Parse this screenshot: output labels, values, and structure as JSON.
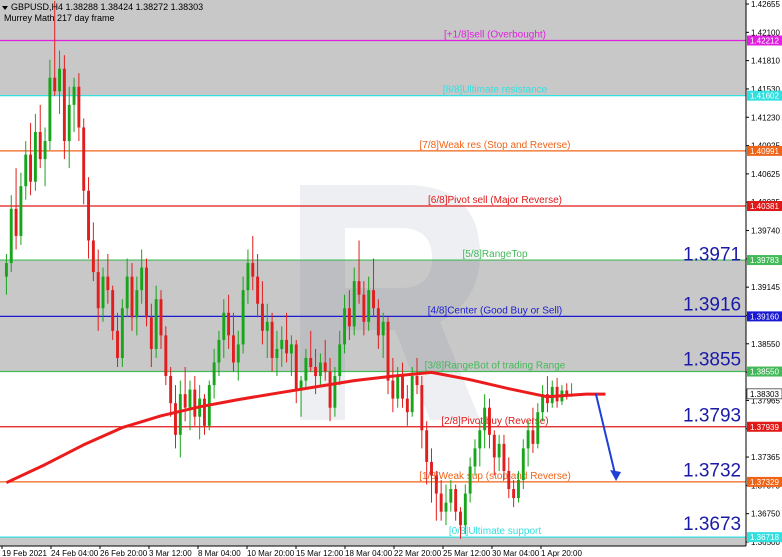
{
  "header": {
    "symbol_line": "GBPUSD,H4  1.38288 1.38424 1.38272 1.38303",
    "indicator_name": "Murrey Math 217 day frame"
  },
  "colors": {
    "up_candle": "#17a51b",
    "down_candle": "#e11d1d",
    "ma_line": "#ec1c1c",
    "arrow": "#1f3fd9",
    "big_label": "#1a1aa8",
    "zone_gray": "#c8c8c8"
  },
  "chart_data": {
    "type": "candlestick",
    "y_range": [
      1.3662,
      1.4266
    ],
    "y_ticks": [
      "1.42655",
      "1.42100",
      "1.41810",
      "1.41530",
      "1.41230",
      "1.40925",
      "1.40625",
      "1.40025",
      "1.39740",
      "1.39440",
      "1.39145",
      "1.38860",
      "1.38550",
      "1.38255",
      "1.37965",
      "1.37655",
      "1.37365",
      "1.37075",
      "1.36750",
      "1.36500"
    ],
    "x_labels": [
      "19 Feb 2021",
      "24 Feb 04:00",
      "26 Feb 20:00",
      "3 Mar 12:00",
      "8 Mar 04:00",
      "10 Mar 20:00",
      "15 Mar 12:00",
      "18 Mar 04:00",
      "22 Mar 20:00",
      "25 Mar 12:00",
      "30 Mar 04:00",
      "1 Apr 20:00"
    ],
    "current_price": "1.38303",
    "murrey_levels": [
      {
        "value": 1.42212,
        "label": "[+1/8]sell (Overbought)",
        "tag": "1.42212",
        "color": "#e020e0"
      },
      {
        "value": 1.41602,
        "label": "[8/8]Ultimate resistance",
        "tag": "1.41602",
        "color": "#33e0e0"
      },
      {
        "value": 1.40991,
        "label": "[7/8]Weak res (Stop and Reverse)",
        "tag": "1.40991",
        "color": "#f06418"
      },
      {
        "value": 1.40381,
        "label": "[6/8]Pivot sell (Major Reverse)",
        "tag": "1.40381",
        "color": "#e01818"
      },
      {
        "value": 1.39783,
        "label": "[5/8]RangeTop",
        "tag": "1.39783",
        "color": "#44b95a"
      },
      {
        "value": 1.3916,
        "label": "[4/8]Center (Good Buy or Sell)",
        "tag": "1.39160",
        "color": "#1a1ad0"
      },
      {
        "value": 1.3855,
        "label": "[3/8]RangeBot of trading Range",
        "tag": "1.38550",
        "color": "#44b95a"
      },
      {
        "value": 1.37939,
        "label": "[2/8]Pivot buy (Reverse)",
        "tag": "1.37939",
        "color": "#e01818"
      },
      {
        "value": 1.37329,
        "label": "[1/8]Weak sup (stop and Reverse)",
        "tag": "1.37329",
        "color": "#f06418"
      },
      {
        "value": 1.36718,
        "label": "[0/8]Ultimate support",
        "tag": "1.36718",
        "color": "#33e0e0"
      }
    ],
    "big_labels": [
      {
        "text": "1.3971",
        "value": 1.3971
      },
      {
        "text": "1.3916",
        "value": 1.3916
      },
      {
        "text": "1.3855",
        "value": 1.3855
      },
      {
        "text": "1.3793",
        "value": 1.3793
      },
      {
        "text": "1.3732",
        "value": 1.3732
      },
      {
        "text": "1.3673",
        "value": 1.3673
      }
    ],
    "forecast_arrow": {
      "from_index": 122,
      "from": 1.3831,
      "to_index": 126,
      "to": 1.3735
    },
    "ma_path": [
      [
        0,
        1.3732
      ],
      [
        8,
        1.3752
      ],
      [
        16,
        1.3774
      ],
      [
        24,
        1.3793
      ],
      [
        32,
        1.3806
      ],
      [
        40,
        1.3816
      ],
      [
        48,
        1.3824
      ],
      [
        56,
        1.3831
      ],
      [
        64,
        1.3838
      ],
      [
        72,
        1.3845
      ],
      [
        80,
        1.385
      ],
      [
        88,
        1.3854
      ],
      [
        96,
        1.3846
      ],
      [
        104,
        1.3836
      ],
      [
        112,
        1.3827
      ],
      [
        120,
        1.383
      ],
      [
        124,
        1.383
      ]
    ],
    "candles": [
      {
        "o": 1.396,
        "h": 1.3985,
        "l": 1.394,
        "c": 1.3975
      },
      {
        "o": 1.3975,
        "h": 1.405,
        "l": 1.3965,
        "c": 1.4035
      },
      {
        "o": 1.4035,
        "h": 1.408,
        "l": 1.399,
        "c": 1.4005
      },
      {
        "o": 1.4005,
        "h": 1.4075,
        "l": 1.3995,
        "c": 1.406
      },
      {
        "o": 1.406,
        "h": 1.411,
        "l": 1.4045,
        "c": 1.4095
      },
      {
        "o": 1.4095,
        "h": 1.413,
        "l": 1.405,
        "c": 1.4065
      },
      {
        "o": 1.4065,
        "h": 1.414,
        "l": 1.4055,
        "c": 1.412
      },
      {
        "o": 1.412,
        "h": 1.415,
        "l": 1.408,
        "c": 1.409
      },
      {
        "o": 1.409,
        "h": 1.4125,
        "l": 1.406,
        "c": 1.411
      },
      {
        "o": 1.411,
        "h": 1.42,
        "l": 1.41,
        "c": 1.418
      },
      {
        "o": 1.418,
        "h": 1.4265,
        "l": 1.416,
        "c": 1.4165
      },
      {
        "o": 1.4165,
        "h": 1.421,
        "l": 1.414,
        "c": 1.419
      },
      {
        "o": 1.419,
        "h": 1.4205,
        "l": 1.409,
        "c": 1.411
      },
      {
        "o": 1.411,
        "h": 1.417,
        "l": 1.408,
        "c": 1.415
      },
      {
        "o": 1.415,
        "h": 1.418,
        "l": 1.412,
        "c": 1.417
      },
      {
        "o": 1.417,
        "h": 1.4185,
        "l": 1.411,
        "c": 1.4125
      },
      {
        "o": 1.4125,
        "h": 1.4135,
        "l": 1.404,
        "c": 1.4055
      },
      {
        "o": 1.4055,
        "h": 1.407,
        "l": 1.398,
        "c": 1.4
      },
      {
        "o": 1.4,
        "h": 1.402,
        "l": 1.3955,
        "c": 1.3965
      },
      {
        "o": 1.3965,
        "h": 1.399,
        "l": 1.39,
        "c": 1.3925
      },
      {
        "o": 1.3925,
        "h": 1.397,
        "l": 1.391,
        "c": 1.396
      },
      {
        "o": 1.396,
        "h": 1.3985,
        "l": 1.393,
        "c": 1.3945
      },
      {
        "o": 1.3945,
        "h": 1.395,
        "l": 1.389,
        "c": 1.39
      },
      {
        "o": 1.39,
        "h": 1.392,
        "l": 1.386,
        "c": 1.387
      },
      {
        "o": 1.387,
        "h": 1.3935,
        "l": 1.386,
        "c": 1.3925
      },
      {
        "o": 1.3925,
        "h": 1.398,
        "l": 1.3915,
        "c": 1.396
      },
      {
        "o": 1.396,
        "h": 1.3975,
        "l": 1.39,
        "c": 1.3915
      },
      {
        "o": 1.3915,
        "h": 1.396,
        "l": 1.3895,
        "c": 1.3945
      },
      {
        "o": 1.3945,
        "h": 1.399,
        "l": 1.393,
        "c": 1.397
      },
      {
        "o": 1.397,
        "h": 1.398,
        "l": 1.3905,
        "c": 1.3915
      },
      {
        "o": 1.3915,
        "h": 1.393,
        "l": 1.386,
        "c": 1.388
      },
      {
        "o": 1.388,
        "h": 1.395,
        "l": 1.387,
        "c": 1.3935
      },
      {
        "o": 1.3935,
        "h": 1.3945,
        "l": 1.388,
        "c": 1.3895
      },
      {
        "o": 1.3895,
        "h": 1.3905,
        "l": 1.384,
        "c": 1.385
      },
      {
        "o": 1.385,
        "h": 1.386,
        "l": 1.3805,
        "c": 1.382
      },
      {
        "o": 1.382,
        "h": 1.384,
        "l": 1.377,
        "c": 1.3785
      },
      {
        "o": 1.3785,
        "h": 1.3845,
        "l": 1.376,
        "c": 1.383
      },
      {
        "o": 1.383,
        "h": 1.386,
        "l": 1.38,
        "c": 1.3815
      },
      {
        "o": 1.3815,
        "h": 1.3845,
        "l": 1.379,
        "c": 1.3835
      },
      {
        "o": 1.3835,
        "h": 1.385,
        "l": 1.3795,
        "c": 1.3805
      },
      {
        "o": 1.3805,
        "h": 1.384,
        "l": 1.378,
        "c": 1.3825
      },
      {
        "o": 1.3825,
        "h": 1.383,
        "l": 1.3785,
        "c": 1.3795
      },
      {
        "o": 1.3795,
        "h": 1.3845,
        "l": 1.379,
        "c": 1.384
      },
      {
        "o": 1.384,
        "h": 1.388,
        "l": 1.3825,
        "c": 1.3865
      },
      {
        "o": 1.3865,
        "h": 1.39,
        "l": 1.385,
        "c": 1.389
      },
      {
        "o": 1.389,
        "h": 1.3935,
        "l": 1.387,
        "c": 1.392
      },
      {
        "o": 1.392,
        "h": 1.394,
        "l": 1.388,
        "c": 1.3895
      },
      {
        "o": 1.3895,
        "h": 1.392,
        "l": 1.3855,
        "c": 1.3865
      },
      {
        "o": 1.3865,
        "h": 1.39,
        "l": 1.3845,
        "c": 1.3885
      },
      {
        "o": 1.3885,
        "h": 1.396,
        "l": 1.3875,
        "c": 1.3945
      },
      {
        "o": 1.3945,
        "h": 1.399,
        "l": 1.393,
        "c": 1.3975
      },
      {
        "o": 1.3975,
        "h": 1.4005,
        "l": 1.3945,
        "c": 1.396
      },
      {
        "o": 1.396,
        "h": 1.3985,
        "l": 1.3915,
        "c": 1.393
      },
      {
        "o": 1.393,
        "h": 1.3955,
        "l": 1.3885,
        "c": 1.39
      },
      {
        "o": 1.39,
        "h": 1.393,
        "l": 1.387,
        "c": 1.391
      },
      {
        "o": 1.391,
        "h": 1.392,
        "l": 1.3855,
        "c": 1.387
      },
      {
        "o": 1.387,
        "h": 1.39,
        "l": 1.385,
        "c": 1.388
      },
      {
        "o": 1.388,
        "h": 1.3905,
        "l": 1.386,
        "c": 1.389
      },
      {
        "o": 1.389,
        "h": 1.392,
        "l": 1.3865,
        "c": 1.3875
      },
      {
        "o": 1.3875,
        "h": 1.3895,
        "l": 1.385,
        "c": 1.3885
      },
      {
        "o": 1.3885,
        "h": 1.389,
        "l": 1.382,
        "c": 1.3835
      },
      {
        "o": 1.3835,
        "h": 1.385,
        "l": 1.3805,
        "c": 1.3845
      },
      {
        "o": 1.3845,
        "h": 1.388,
        "l": 1.3835,
        "c": 1.387
      },
      {
        "o": 1.387,
        "h": 1.39,
        "l": 1.3855,
        "c": 1.386
      },
      {
        "o": 1.386,
        "h": 1.388,
        "l": 1.383,
        "c": 1.385
      },
      {
        "o": 1.385,
        "h": 1.3875,
        "l": 1.384,
        "c": 1.3865
      },
      {
        "o": 1.3865,
        "h": 1.389,
        "l": 1.3845,
        "c": 1.3855
      },
      {
        "o": 1.3855,
        "h": 1.387,
        "l": 1.38,
        "c": 1.3815
      },
      {
        "o": 1.3815,
        "h": 1.386,
        "l": 1.3805,
        "c": 1.385
      },
      {
        "o": 1.385,
        "h": 1.39,
        "l": 1.384,
        "c": 1.3885
      },
      {
        "o": 1.3885,
        "h": 1.394,
        "l": 1.3875,
        "c": 1.3925
      },
      {
        "o": 1.3925,
        "h": 1.3945,
        "l": 1.389,
        "c": 1.3905
      },
      {
        "o": 1.3905,
        "h": 1.397,
        "l": 1.3895,
        "c": 1.3955
      },
      {
        "o": 1.3955,
        "h": 1.4,
        "l": 1.393,
        "c": 1.394
      },
      {
        "o": 1.394,
        "h": 1.3955,
        "l": 1.3895,
        "c": 1.391
      },
      {
        "o": 1.391,
        "h": 1.396,
        "l": 1.39,
        "c": 1.3945
      },
      {
        "o": 1.3945,
        "h": 1.398,
        "l": 1.3915,
        "c": 1.3925
      },
      {
        "o": 1.3925,
        "h": 1.3935,
        "l": 1.388,
        "c": 1.3895
      },
      {
        "o": 1.3895,
        "h": 1.392,
        "l": 1.387,
        "c": 1.391
      },
      {
        "o": 1.391,
        "h": 1.3915,
        "l": 1.383,
        "c": 1.3845
      },
      {
        "o": 1.3845,
        "h": 1.387,
        "l": 1.381,
        "c": 1.3825
      },
      {
        "o": 1.3825,
        "h": 1.386,
        "l": 1.3815,
        "c": 1.385
      },
      {
        "o": 1.385,
        "h": 1.3865,
        "l": 1.3815,
        "c": 1.3825
      },
      {
        "o": 1.3825,
        "h": 1.384,
        "l": 1.3795,
        "c": 1.381
      },
      {
        "o": 1.381,
        "h": 1.386,
        "l": 1.3805,
        "c": 1.385
      },
      {
        "o": 1.385,
        "h": 1.387,
        "l": 1.383,
        "c": 1.384
      },
      {
        "o": 1.384,
        "h": 1.385,
        "l": 1.377,
        "c": 1.379
      },
      {
        "o": 1.379,
        "h": 1.38,
        "l": 1.373,
        "c": 1.3755
      },
      {
        "o": 1.3755,
        "h": 1.377,
        "l": 1.371,
        "c": 1.374
      },
      {
        "o": 1.374,
        "h": 1.3745,
        "l": 1.369,
        "c": 1.372
      },
      {
        "o": 1.372,
        "h": 1.3735,
        "l": 1.369,
        "c": 1.37
      },
      {
        "o": 1.37,
        "h": 1.373,
        "l": 1.3685,
        "c": 1.371
      },
      {
        "o": 1.371,
        "h": 1.3735,
        "l": 1.37,
        "c": 1.3725
      },
      {
        "o": 1.3725,
        "h": 1.373,
        "l": 1.369,
        "c": 1.37
      },
      {
        "o": 1.37,
        "h": 1.3705,
        "l": 1.367,
        "c": 1.3685
      },
      {
        "o": 1.3685,
        "h": 1.373,
        "l": 1.3675,
        "c": 1.372
      },
      {
        "o": 1.372,
        "h": 1.376,
        "l": 1.371,
        "c": 1.375
      },
      {
        "o": 1.375,
        "h": 1.378,
        "l": 1.374,
        "c": 1.377
      },
      {
        "o": 1.377,
        "h": 1.38,
        "l": 1.375,
        "c": 1.379
      },
      {
        "o": 1.379,
        "h": 1.383,
        "l": 1.377,
        "c": 1.3815
      },
      {
        "o": 1.3815,
        "h": 1.3825,
        "l": 1.377,
        "c": 1.3785
      },
      {
        "o": 1.3785,
        "h": 1.379,
        "l": 1.374,
        "c": 1.376
      },
      {
        "o": 1.376,
        "h": 1.3785,
        "l": 1.3745,
        "c": 1.3775
      },
      {
        "o": 1.3775,
        "h": 1.3785,
        "l": 1.3735,
        "c": 1.3745
      },
      {
        "o": 1.3745,
        "h": 1.376,
        "l": 1.3715,
        "c": 1.3725
      },
      {
        "o": 1.3725,
        "h": 1.3735,
        "l": 1.3705,
        "c": 1.3715
      },
      {
        "o": 1.3715,
        "h": 1.3745,
        "l": 1.371,
        "c": 1.3735
      },
      {
        "o": 1.3735,
        "h": 1.378,
        "l": 1.3725,
        "c": 1.377
      },
      {
        "o": 1.377,
        "h": 1.38,
        "l": 1.375,
        "c": 1.379
      },
      {
        "o": 1.379,
        "h": 1.3815,
        "l": 1.3765,
        "c": 1.3775
      },
      {
        "o": 1.3775,
        "h": 1.382,
        "l": 1.377,
        "c": 1.381
      },
      {
        "o": 1.381,
        "h": 1.384,
        "l": 1.38,
        "c": 1.383
      },
      {
        "o": 1.383,
        "h": 1.385,
        "l": 1.381,
        "c": 1.382
      },
      {
        "o": 1.382,
        "h": 1.3845,
        "l": 1.3815,
        "c": 1.3838
      },
      {
        "o": 1.3838,
        "h": 1.3848,
        "l": 1.3815,
        "c": 1.3822
      },
      {
        "o": 1.3822,
        "h": 1.384,
        "l": 1.3818,
        "c": 1.3834
      },
      {
        "o": 1.3834,
        "h": 1.3842,
        "l": 1.3824,
        "c": 1.3828
      },
      {
        "o": 1.3828,
        "h": 1.3842,
        "l": 1.3827,
        "c": 1.383
      }
    ]
  }
}
